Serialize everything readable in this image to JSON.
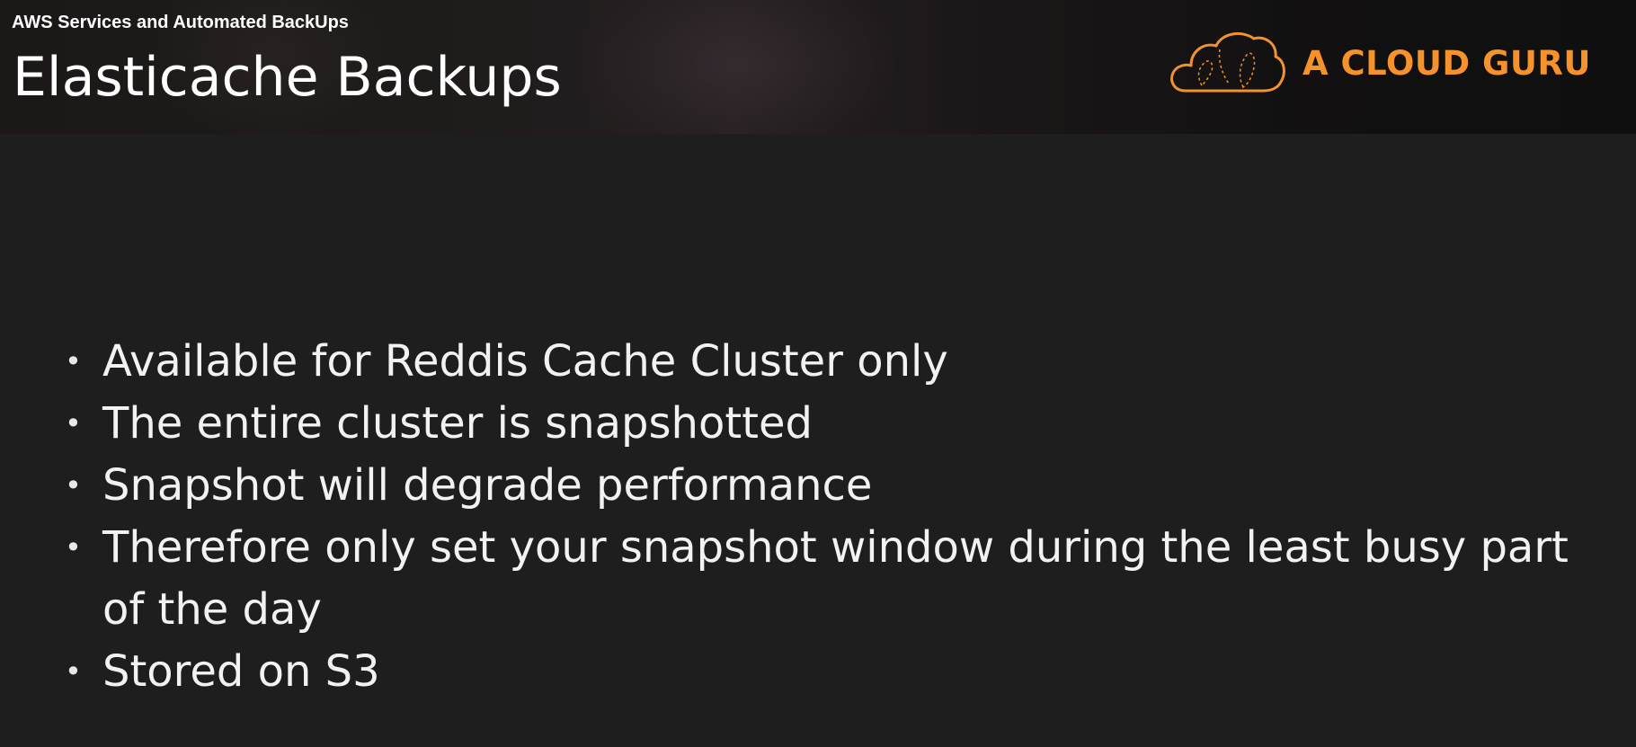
{
  "header": {
    "breadcrumb": "AWS Services and Automated BackUps",
    "title": "Elasticache Backups"
  },
  "logo": {
    "text": "A CLOUD GURU",
    "icon": "cloud-icon",
    "color": "#f5922b"
  },
  "bullets": [
    "Available for Reddis Cache Cluster only",
    "The entire cluster is snapshotted",
    "Snapshot will degrade performance",
    "Therefore only set your snapshot window during the least busy part of the day",
    "Stored on S3"
  ],
  "colors": {
    "background": "#1e1e1e",
    "text": "#f2f2f2",
    "accent": "#f5922b"
  }
}
